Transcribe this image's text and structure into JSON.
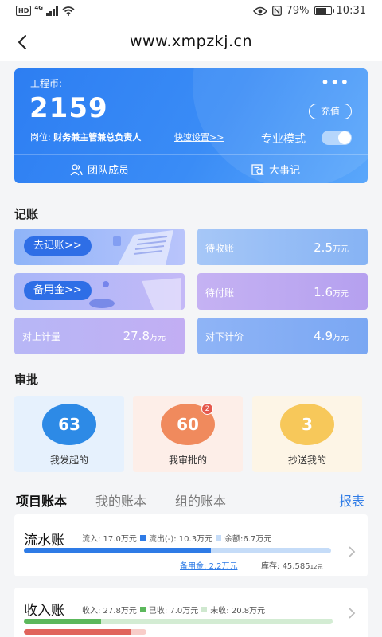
{
  "status_bar": {
    "hd": "HD",
    "network": "4G",
    "battery": "79%",
    "battery_level": 0.79,
    "time": "10:31"
  },
  "nav": {
    "title": "www.xmpzkj.cn"
  },
  "account_card": {
    "coin_label": "工程币:",
    "coin_value": "2159",
    "recharge": "充值",
    "position_label": "岗位:",
    "position_value": "财务兼主管兼总负责人",
    "quick_settings": "快速设置>>",
    "pro_mode": "专业模式",
    "pro_mode_on": true,
    "tab_team": "团队成员",
    "tab_events": "大事记"
  },
  "bookkeeping": {
    "title": "记账",
    "go_bookkeeping": "去记账>>",
    "reserve_fund": "备用金>>",
    "receivable": {
      "label": "待收账",
      "value": "2.5",
      "unit": "万元"
    },
    "payable": {
      "label": "待付账",
      "value": "1.6",
      "unit": "万元"
    },
    "upper_measure": {
      "label": "对上计量",
      "value": "27.8",
      "unit": "万元"
    },
    "lower_pricing": {
      "label": "对下计价",
      "value": "4.9",
      "unit": "万元"
    }
  },
  "approval": {
    "title": "审批",
    "items": [
      {
        "count": "63",
        "label": "我发起的",
        "badge": ""
      },
      {
        "count": "60",
        "label": "我审批的",
        "badge": "2"
      },
      {
        "count": "3",
        "label": "抄送我的",
        "badge": ""
      }
    ]
  },
  "ledgers": {
    "tabs": [
      "项目账本",
      "我的账本",
      "组的账本"
    ],
    "report": "报表",
    "flow": {
      "title": "流水账",
      "inflow": "流入: 17.0万元",
      "outflow": "流出(-): 10.3万元",
      "balance": "余额:6.7万元",
      "reserve_label": "备用金:",
      "reserve_value": "2.2万元",
      "stock_label": "库存:",
      "stock_value": "45,585",
      "stock_unit": "12元",
      "outflow_ratio": 0.61
    },
    "income": {
      "title": "收入账",
      "income": "收入: 27.8万元",
      "received": "已收: 7.0万元",
      "unreceived": "未收: 20.8万元",
      "received_ratio": 0.25,
      "secondary_ratio": 0.35
    }
  },
  "colors": {
    "primary": "#2e7be6",
    "blue_dark": "#2e6ee6",
    "orange": "#f08a5d",
    "yellow": "#f7c85a",
    "green": "#5cb85c",
    "red": "#e0645c"
  }
}
